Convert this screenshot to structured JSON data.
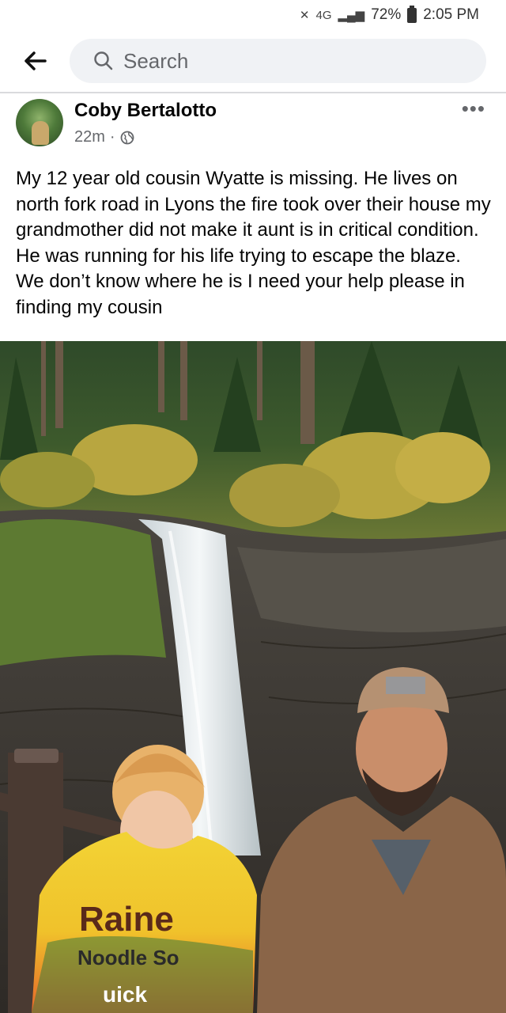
{
  "status_bar": {
    "battery": "72%",
    "time": "2:05 PM",
    "network": "4G"
  },
  "header": {
    "back_icon": "arrow-left-icon",
    "search_placeholder": "Search"
  },
  "post": {
    "author": "Coby Bertalotto",
    "time_ago": "22m",
    "privacy_icon": "globe-icon",
    "text": "My 12 year old cousin Wyatte is missing. He lives on north fork road in Lyons the fire took over their house my grandmother did not make it aunt is in critical condition. He was running for his life trying to escape the blaze. We don’t know where he is I need your help please in finding my cousin"
  },
  "photo": {
    "shirt_text_line1": "Raine",
    "shirt_text_line2": "Noodle So",
    "shirt_text_line3": "uick"
  }
}
